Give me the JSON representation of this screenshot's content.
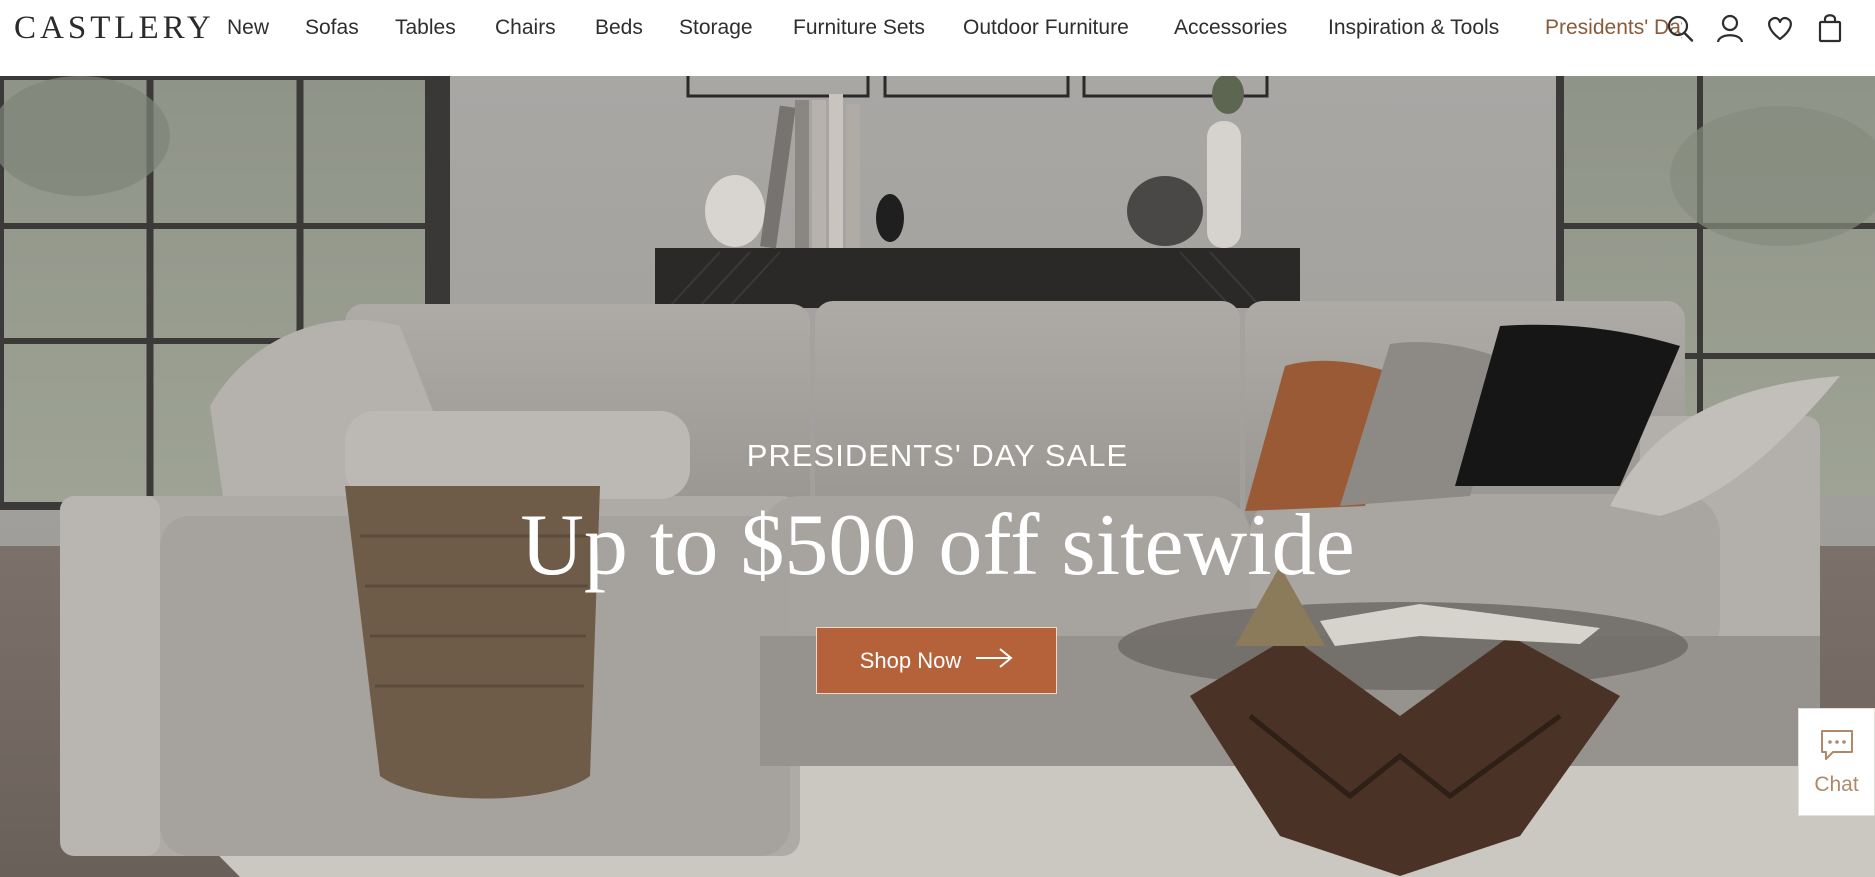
{
  "brand": {
    "name": "CASTLERY"
  },
  "nav": {
    "items": [
      {
        "label": "New"
      },
      {
        "label": "Sofas"
      },
      {
        "label": "Tables"
      },
      {
        "label": "Chairs"
      },
      {
        "label": "Beds"
      },
      {
        "label": "Storage"
      },
      {
        "label": "Furniture Sets"
      },
      {
        "label": "Outdoor Furniture"
      },
      {
        "label": "Accessories"
      },
      {
        "label": "Inspiration & Tools"
      },
      {
        "label": "Presidents' Day Sale"
      }
    ]
  },
  "header_icons": [
    "search-icon",
    "account-icon",
    "wishlist-heart-icon",
    "shopping-bag-icon"
  ],
  "hero": {
    "eyebrow": "PRESIDENTS' DAY SALE",
    "title": "Up to $500 off sitewide",
    "cta_label": "Shop Now"
  },
  "chat": {
    "label": "Chat",
    "icon": "chat-bubble-icon"
  },
  "colors": {
    "accent": "#b5613a",
    "promo_text": "#8a5a3a",
    "text": "#2e2e2e",
    "chat_text": "#b08a68"
  }
}
